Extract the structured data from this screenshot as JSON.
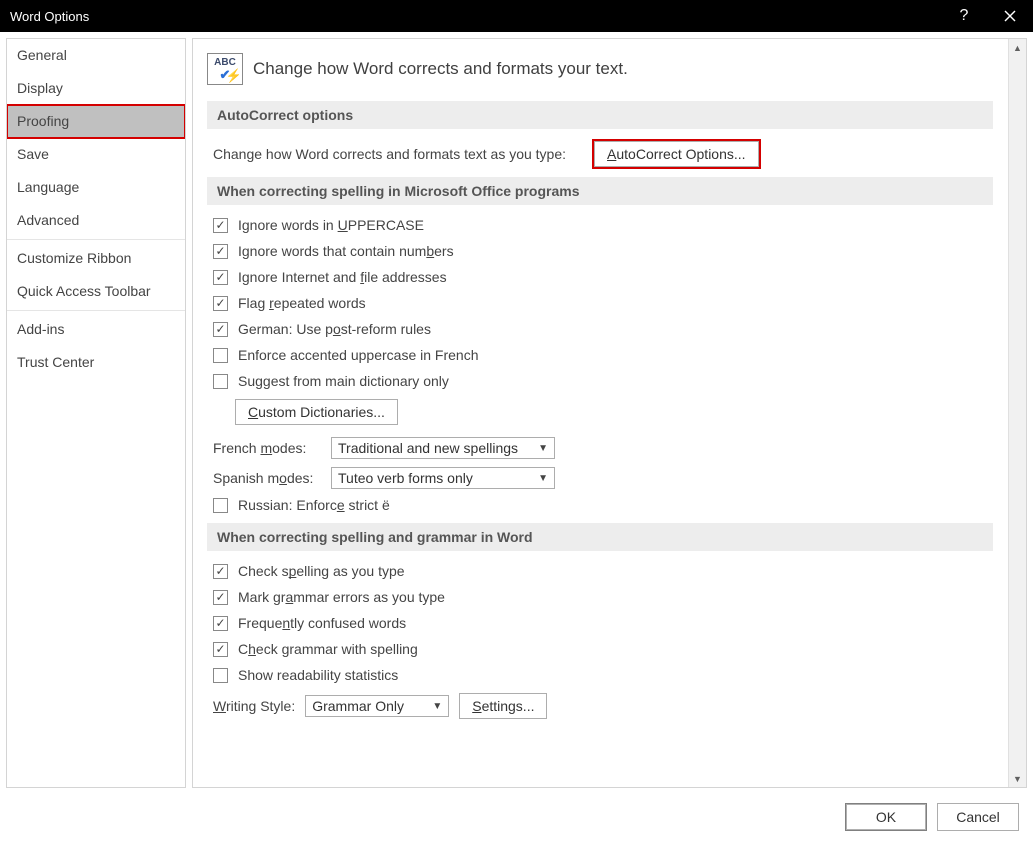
{
  "title": "Word Options",
  "sidebar": {
    "items": [
      {
        "label": "General"
      },
      {
        "label": "Display"
      },
      {
        "label": "Proofing",
        "selected": true,
        "highlighted": true
      },
      {
        "label": "Save"
      },
      {
        "label": "Language"
      },
      {
        "label": "Advanced"
      },
      {
        "label": "Customize Ribbon"
      },
      {
        "label": "Quick Access Toolbar"
      },
      {
        "label": "Add-ins"
      },
      {
        "label": "Trust Center"
      }
    ]
  },
  "header": {
    "icon_text": "ABC",
    "text": "Change how Word corrects and formats your text."
  },
  "sections": {
    "autocorrect": {
      "title": "AutoCorrect options",
      "desc": "Change how Word corrects and formats text as you type:",
      "button_pre": "A",
      "button_rest": "utoCorrect Options..."
    },
    "spelling_office": {
      "title": "When correcting spelling in Microsoft Office programs",
      "opts": [
        {
          "pre": "Ignore words in ",
          "u": "U",
          "post": "PPERCASE",
          "checked": true
        },
        {
          "pre": "Ignore words that contain num",
          "u": "b",
          "post": "ers",
          "checked": true
        },
        {
          "pre": "Ignore Internet and ",
          "u": "f",
          "post": "ile addresses",
          "checked": true
        },
        {
          "pre": "Flag ",
          "u": "r",
          "post": "epeated words",
          "checked": true
        },
        {
          "pre": "German: Use p",
          "u": "o",
          "post": "st-reform rules",
          "checked": true
        },
        {
          "pre": "Enforce accented uppercase in French",
          "u": "",
          "post": "",
          "checked": false
        },
        {
          "pre": "Suggest from main dictionary only",
          "u": "",
          "post": "",
          "checked": false
        }
      ],
      "custom_dict_pre": "C",
      "custom_dict_rest": "ustom Dictionaries...",
      "french_label_pre": "French ",
      "french_label_u": "m",
      "french_label_post": "odes:",
      "french_value": "Traditional and new spellings",
      "spanish_label_pre": "Spanish m",
      "spanish_label_u": "o",
      "spanish_label_post": "des:",
      "spanish_value": "Tuteo verb forms only",
      "russian_pre": "Russian: Enforc",
      "russian_u": "e",
      "russian_post": " strict ё",
      "russian_checked": false
    },
    "spelling_word": {
      "title": "When correcting spelling and grammar in Word",
      "opts": [
        {
          "pre": "Check s",
          "u": "p",
          "post": "elling as you type",
          "checked": true
        },
        {
          "pre": "Mark gr",
          "u": "a",
          "post": "mmar errors as you type",
          "checked": true
        },
        {
          "pre": "Freque",
          "u": "n",
          "post": "tly confused words",
          "checked": true
        },
        {
          "pre": "C",
          "u": "h",
          "post": "eck grammar with spelling",
          "checked": true
        },
        {
          "pre": "Show readability statistics",
          "u": "",
          "post": "",
          "checked": false
        }
      ],
      "writing_label_pre": "W",
      "writing_label_rest": "riting Style:",
      "writing_value": "Grammar Only",
      "settings_pre": "S",
      "settings_rest": "ettings..."
    }
  },
  "footer": {
    "ok": "OK",
    "cancel": "Cancel"
  }
}
